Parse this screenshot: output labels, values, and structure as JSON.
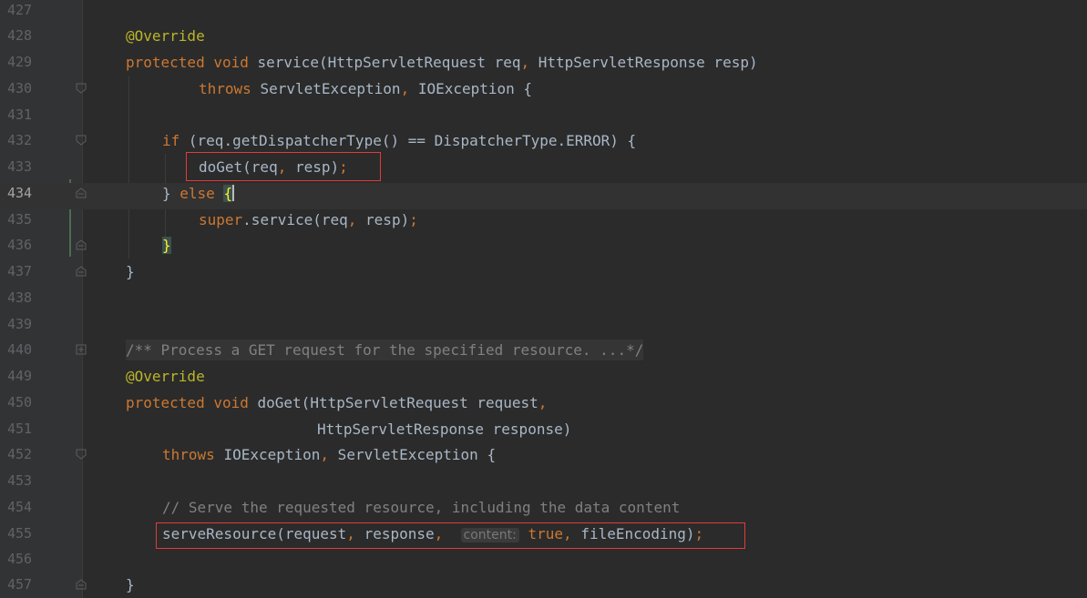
{
  "editor": {
    "lines": [
      {
        "num": "427"
      },
      {
        "num": "428",
        "annotation": "@Override"
      },
      {
        "num": "429",
        "kw1": "protected",
        "kw2": "void",
        "sig": "service(HttpServletRequest req",
        "comma": ",",
        "sig2": " HttpServletResponse resp)"
      },
      {
        "num": "430",
        "kw": "throws",
        "t1": "ServletException",
        "comma": ",",
        "t2": " IOException {"
      },
      {
        "num": "431"
      },
      {
        "num": "432",
        "kw": "if",
        "t": "(req.getDispatcherType() == DispatcherType.ERROR) {"
      },
      {
        "num": "433",
        "t1": "doGet(req",
        "comma": ",",
        "t2": " resp)",
        "semi": ";"
      },
      {
        "num": "434",
        "t1": "} ",
        "kw": "else",
        "brace": "{"
      },
      {
        "num": "435",
        "kw": "super",
        "t1": ".service(req",
        "comma": ",",
        "t2": " resp)",
        "semi": ";"
      },
      {
        "num": "436",
        "brace": "}"
      },
      {
        "num": "437",
        "t": "}"
      },
      {
        "num": "438"
      },
      {
        "num": "439"
      },
      {
        "num": "440",
        "doc": "/** Process a GET request for the specified resource. ...*/"
      },
      {
        "num": "449",
        "annotation": "@Override"
      },
      {
        "num": "450",
        "kw1": "protected",
        "kw2": "void",
        "sig": "doGet(HttpServletRequest request",
        "comma": ","
      },
      {
        "num": "451",
        "t": "HttpServletResponse response)"
      },
      {
        "num": "452",
        "kw": "throws",
        "t1": "IOException",
        "comma": ",",
        "t2": " ServletException {"
      },
      {
        "num": "453"
      },
      {
        "num": "454",
        "comment": "// Serve the requested resource, including the data content"
      },
      {
        "num": "455",
        "t1": "serveResource(request",
        "c1": ",",
        "t2": " response",
        "c2": ",",
        "hint": "content:",
        "kw": "true",
        "c3": ",",
        "t3": " fileEncoding)",
        "semi": ";"
      },
      {
        "num": "456"
      },
      {
        "num": "457",
        "t": "}"
      }
    ]
  },
  "colors": {
    "background": "#2b2b2b",
    "gutter": "#313335",
    "keyword": "#cc7832",
    "annotation": "#bbb529",
    "comment": "#808080",
    "text": "#a9b7c6",
    "highlight_box": "#e33a3a"
  }
}
